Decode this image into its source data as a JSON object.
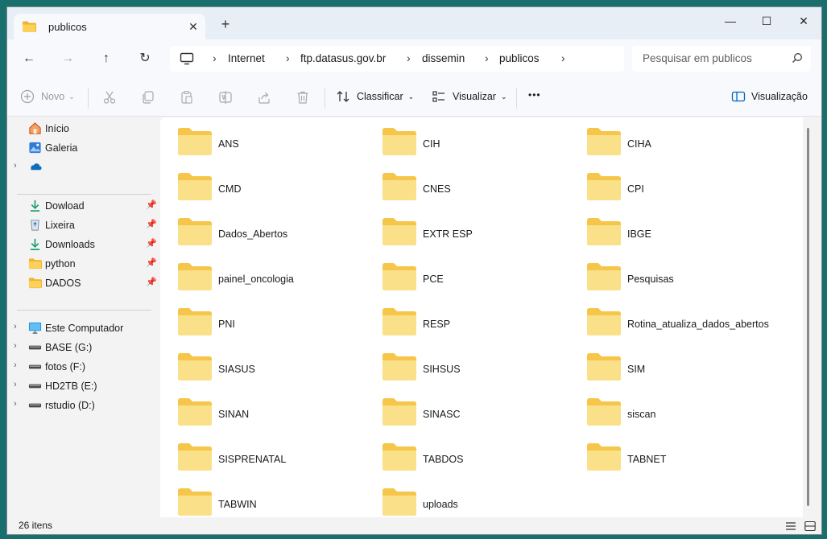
{
  "tab": {
    "title": "publicos",
    "close": "✕",
    "new": "+"
  },
  "window": {
    "minimize": "—",
    "maximize": "☐",
    "close": "✕"
  },
  "nav": {
    "back": "←",
    "forward": "→",
    "up": "↑",
    "refresh": "↻"
  },
  "breadcrumb": [
    "Internet",
    "ftp.datasus.gov.br",
    "dissemin",
    "publicos"
  ],
  "search": {
    "placeholder": "Pesquisar em publicos"
  },
  "toolbar": {
    "new_label": "Novo",
    "sort_label": "Classificar",
    "view_label": "Visualizar",
    "more_label": "•••",
    "preview_label": "Visualização"
  },
  "sidebar": {
    "top": [
      {
        "label": "Início",
        "icon": "home-icon"
      },
      {
        "label": "Galeria",
        "icon": "gallery-icon"
      },
      {
        "label": "",
        "icon": "onedrive-icon"
      }
    ],
    "pinned": [
      {
        "label": "Dowload",
        "icon": "download-icon"
      },
      {
        "label": "Lixeira",
        "icon": "recycle-bin-icon"
      },
      {
        "label": "Downloads",
        "icon": "download-icon"
      },
      {
        "label": "python",
        "icon": "folder-icon"
      },
      {
        "label": "DADOS",
        "icon": "folder-icon"
      }
    ],
    "drives": [
      {
        "label": "Este Computador",
        "icon": "computer-icon"
      },
      {
        "label": "BASE (G:)",
        "icon": "drive-icon"
      },
      {
        "label": "fotos (F:)",
        "icon": "drive-icon"
      },
      {
        "label": "HD2TB (E:)",
        "icon": "drive-icon"
      },
      {
        "label": "rstudio (D:)",
        "icon": "drive-icon"
      }
    ]
  },
  "folders": [
    "ANS",
    "CIH",
    "CIHA",
    "CMD",
    "CNES",
    "CPI",
    "Dados_Abertos",
    "EXTR ESP",
    "IBGE",
    "painel_oncologia",
    "PCE",
    "Pesquisas",
    "PNI",
    "RESP",
    "Rotina_atualiza_dados_abertos",
    "SIASUS",
    "SIHSUS",
    "SIM",
    "SINAN",
    "SINASC",
    "siscan",
    "SISPRENATAL",
    "TABDOS",
    "TABNET",
    "TABWIN",
    "uploads"
  ],
  "status": {
    "count": "26 itens"
  },
  "colors": {
    "folder": "#f6c64a",
    "folder_light": "#fbe08a",
    "accent": "#0067c0"
  }
}
